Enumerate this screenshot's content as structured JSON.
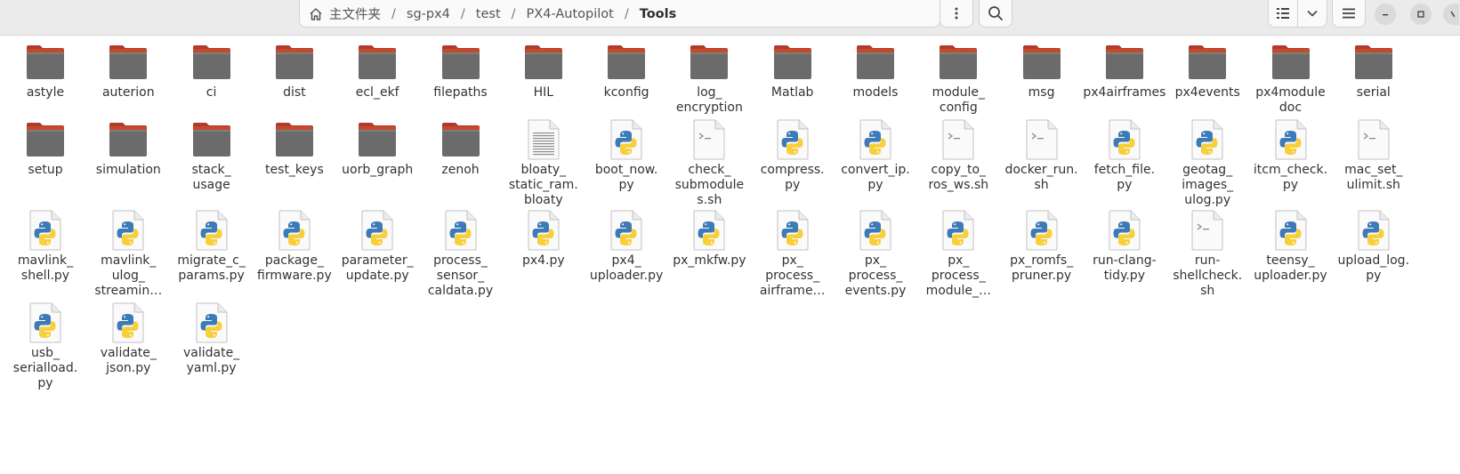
{
  "path": {
    "crumbs": [
      "主文件夹",
      "sg-px4",
      "test",
      "PX4-Autopilot",
      "Tools"
    ],
    "separator": "/"
  },
  "colors": {
    "folder_body": "#6b6b6b",
    "folder_tab": "#b03a2e",
    "folder_top": "#c44a2a"
  },
  "files": [
    {
      "label": "astyle",
      "type": "folder"
    },
    {
      "label": "auterion",
      "type": "folder"
    },
    {
      "label": "ci",
      "type": "folder"
    },
    {
      "label": "dist",
      "type": "folder"
    },
    {
      "label": "ecl_ekf",
      "type": "folder"
    },
    {
      "label": "filepaths",
      "type": "folder"
    },
    {
      "label": "HIL",
      "type": "folder"
    },
    {
      "label": "kconfig",
      "type": "folder"
    },
    {
      "label": "log_\nencryption",
      "type": "folder"
    },
    {
      "label": "Matlab",
      "type": "folder"
    },
    {
      "label": "models",
      "type": "folder"
    },
    {
      "label": "module_\nconfig",
      "type": "folder"
    },
    {
      "label": "msg",
      "type": "folder"
    },
    {
      "label": "px4airframes",
      "type": "folder"
    },
    {
      "label": "px4events",
      "type": "folder"
    },
    {
      "label": "px4module\ndoc",
      "type": "folder"
    },
    {
      "label": "serial",
      "type": "folder"
    },
    {
      "label": "setup",
      "type": "folder"
    },
    {
      "label": "simulation",
      "type": "folder"
    },
    {
      "label": "stack_\nusage",
      "type": "folder"
    },
    {
      "label": "test_keys",
      "type": "folder"
    },
    {
      "label": "uorb_graph",
      "type": "folder"
    },
    {
      "label": "zenoh",
      "type": "folder"
    },
    {
      "label": "bloaty_\nstatic_ram.\nbloaty",
      "type": "text"
    },
    {
      "label": "boot_now.\npy",
      "type": "python"
    },
    {
      "label": "check_\nsubmodule\ns.sh",
      "type": "script"
    },
    {
      "label": "compress.\npy",
      "type": "python"
    },
    {
      "label": "convert_ip.\npy",
      "type": "python"
    },
    {
      "label": "copy_to_\nros_ws.sh",
      "type": "script"
    },
    {
      "label": "docker_run.\nsh",
      "type": "script"
    },
    {
      "label": "fetch_file.\npy",
      "type": "python"
    },
    {
      "label": "geotag_\nimages_\nulog.py",
      "type": "python"
    },
    {
      "label": "itcm_check.\npy",
      "type": "python"
    },
    {
      "label": "mac_set_\nulimit.sh",
      "type": "script"
    },
    {
      "label": "mavlink_\nshell.py",
      "type": "python"
    },
    {
      "label": "mavlink_\nulog_\nstreamin…",
      "type": "python"
    },
    {
      "label": "migrate_c_\nparams.py",
      "type": "python"
    },
    {
      "label": "package_\nfirmware.py",
      "type": "python"
    },
    {
      "label": "parameter_\nupdate.py",
      "type": "python"
    },
    {
      "label": "process_\nsensor_\ncaldata.py",
      "type": "python"
    },
    {
      "label": "px4.py",
      "type": "python"
    },
    {
      "label": "px4_\nuploader.py",
      "type": "python"
    },
    {
      "label": "px_mkfw.py",
      "type": "python"
    },
    {
      "label": "px_\nprocess_\nairframe…",
      "type": "python"
    },
    {
      "label": "px_\nprocess_\nevents.py",
      "type": "python"
    },
    {
      "label": "px_\nprocess_\nmodule_…",
      "type": "python"
    },
    {
      "label": "px_romfs_\npruner.py",
      "type": "python"
    },
    {
      "label": "run-clang-\ntidy.py",
      "type": "python"
    },
    {
      "label": "run-\nshellcheck.\nsh",
      "type": "script"
    },
    {
      "label": "teensy_\nuploader.py",
      "type": "python"
    },
    {
      "label": "upload_log.\npy",
      "type": "python"
    },
    {
      "label": "usb_\nserialload.\npy",
      "type": "python"
    },
    {
      "label": "validate_\njson.py",
      "type": "python"
    },
    {
      "label": "validate_\nyaml.py",
      "type": "python"
    }
  ]
}
